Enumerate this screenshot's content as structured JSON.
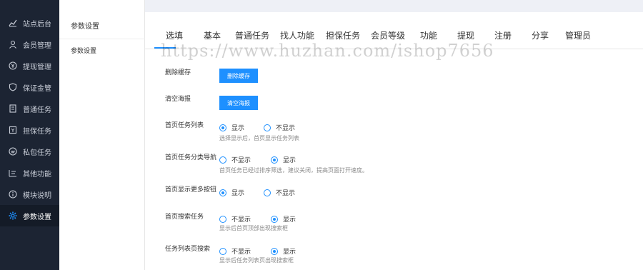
{
  "sidebar": {
    "items": [
      {
        "label": "站点后台",
        "icon": "line-chart-icon"
      },
      {
        "label": "会员管理",
        "icon": "user-icon"
      },
      {
        "label": "提现管理",
        "icon": "yuan-circle-icon"
      },
      {
        "label": "保证金管",
        "icon": "shield-icon"
      },
      {
        "label": "普通任务",
        "icon": "document-icon"
      },
      {
        "label": "担保任务",
        "icon": "guarantee-icon"
      },
      {
        "label": "私包任务",
        "icon": "private-task-icon"
      },
      {
        "label": "其他功能",
        "icon": "list-icon"
      },
      {
        "label": "模块说明",
        "icon": "info-icon"
      },
      {
        "label": "参数设置",
        "icon": "gear-icon"
      }
    ]
  },
  "subpanel": {
    "title": "参数设置",
    "item": "参数设置"
  },
  "tabs": [
    "选填",
    "基本",
    "普通任务",
    "找人功能",
    "担保任务",
    "会员等级",
    "功能",
    "提现",
    "注册",
    "分享",
    "管理员"
  ],
  "watermark": "https://www.huzhan.com/ishop7656",
  "settings": {
    "clear_cache": {
      "label": "删除缓存",
      "button": "删除缓存"
    },
    "clear_poster": {
      "label": "清空海报",
      "button": "清空海报"
    },
    "home_task_list": {
      "label": "首页任务列表",
      "opt1": "显示",
      "opt2": "不显示",
      "hint": "选择显示后，首页显示任务列表"
    },
    "home_category_nav": {
      "label": "首页任务分类导航",
      "opt1": "不显示",
      "opt2": "显示",
      "hint": "首页任务已经过排序筛选，建议关闭，提高页面打开速度。"
    },
    "home_more_button": {
      "label": "首页显示更多按钮",
      "opt1": "显示",
      "opt2": "不显示"
    },
    "home_search": {
      "label": "首页搜索任务",
      "opt1": "不显示",
      "opt2": "显示",
      "hint": "显示后首页顶部出现搜索框"
    },
    "task_list_search": {
      "label": "任务列表页搜索",
      "opt1": "不显示",
      "opt2": "显示",
      "hint": "显示后任务列表页出现搜索框"
    }
  },
  "colors": {
    "sidebar": "#1c2433",
    "accent": "#1e90ff"
  }
}
